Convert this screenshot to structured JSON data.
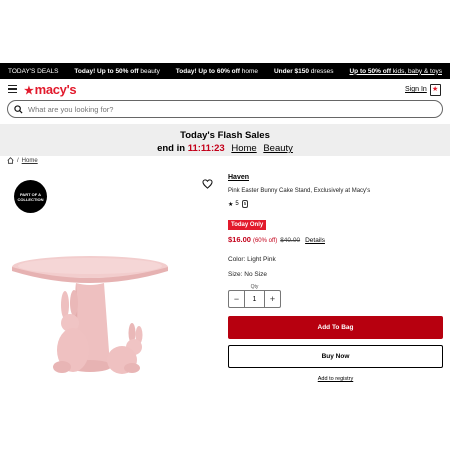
{
  "promo_bar": {
    "deals": "TODAY'S DEALS",
    "promo1_bold": "Today! Up to 50% off",
    "promo1_rest": " beauty",
    "promo2_bold": "Today! Up to 60% off",
    "promo2_rest": " home",
    "promo3_bold": "Under $150",
    "promo3_rest": " dresses",
    "promo4_bold": "Up to 50% off",
    "promo4_rest": " kids, baby & toys"
  },
  "header": {
    "logo": "macy's",
    "sign_in": "Sign In",
    "bag_icon": "shopping-bag-icon"
  },
  "search": {
    "placeholder": "What are you looking for?"
  },
  "flash": {
    "title": "Today's Flash Sales",
    "ends_label": "end in",
    "timer": "11:11:23",
    "link1": "Home",
    "link2": "Beauty"
  },
  "breadcrumb": {
    "separator": "/",
    "item": "Home"
  },
  "badge": {
    "line1": "PART OF A",
    "line2": "COLLECTION"
  },
  "product": {
    "brand": "Haven",
    "title": "Pink Easter Bunny Cake Stand, Exclusively at Macy's",
    "rating_star": "★",
    "rating_value": "5",
    "review_count": "5",
    "today_only": "Today Only",
    "sale_price": "$16.00",
    "discount": "(60% off)",
    "original_price": "$40.00",
    "details_link": "Details",
    "color_label": "Color: Light Pink",
    "size_label": "Size: No Size",
    "qty_label": "Qty",
    "qty_value": "1",
    "add_to_bag": "Add To Bag",
    "buy_now": "Buy Now",
    "add_to_registry": "Add to registry"
  },
  "colors": {
    "brand_red": "#e21a2c",
    "add_to_bag_bg": "#b7000f",
    "sale_red": "#c4001a",
    "product_pink": "#efc1c1"
  }
}
